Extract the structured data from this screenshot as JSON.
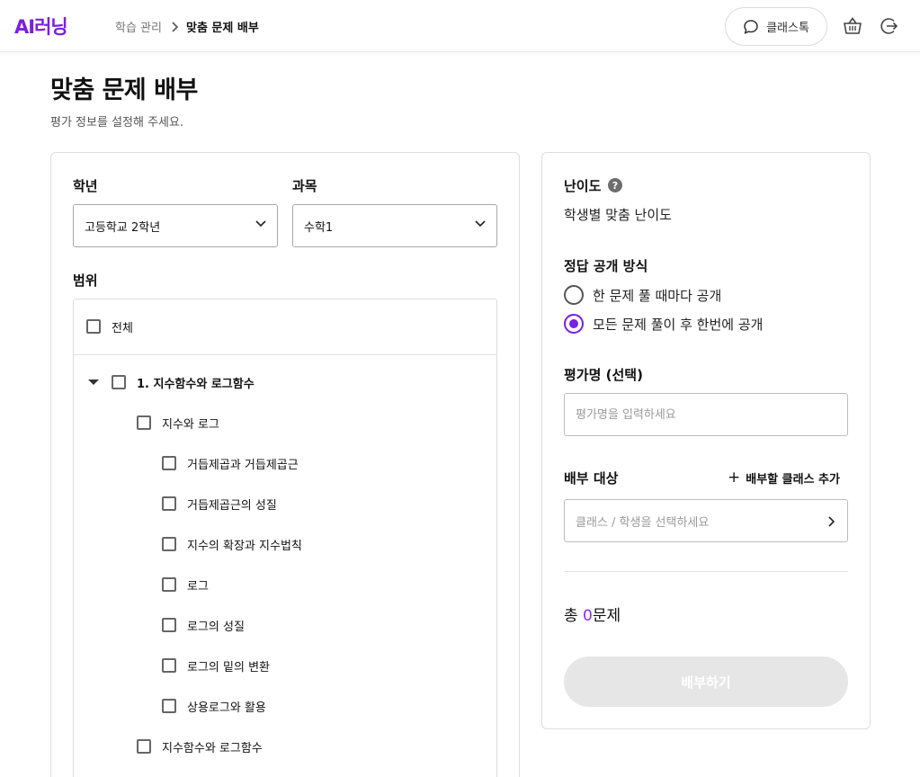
{
  "header": {
    "logo": "AI러닝",
    "breadcrumb_parent": "학습 관리",
    "breadcrumb_current": "맞춤 문제 배부",
    "classtalk_label": "클래스톡"
  },
  "page": {
    "title": "맞춤 문제 배부",
    "subtitle": "평가 정보를 설정해 주세요."
  },
  "left": {
    "grade_label": "학년",
    "grade_value": "고등학교 2학년",
    "subject_label": "과목",
    "subject_value": "수학1",
    "range_label": "범위",
    "all_label": "전체",
    "tree": [
      {
        "level": 0,
        "label": "1. 지수함수와 로그함수",
        "expanded": true
      },
      {
        "level": 1,
        "label": "지수와 로그"
      },
      {
        "level": 2,
        "label": "거듭제곱과 거듭제곱근"
      },
      {
        "level": 2,
        "label": "거듭제곱근의 성질"
      },
      {
        "level": 2,
        "label": "지수의 확장과 지수법칙"
      },
      {
        "level": 2,
        "label": "로그"
      },
      {
        "level": 2,
        "label": "로그의 성질"
      },
      {
        "level": 2,
        "label": "로그의 밑의 변환"
      },
      {
        "level": 2,
        "label": "상용로그와 활용"
      },
      {
        "level": 1,
        "label": "지수함수와 로그함수"
      }
    ]
  },
  "right": {
    "difficulty_label": "난이도",
    "help_glyph": "?",
    "difficulty_value": "학생별 맞춤 난이도",
    "answer_label": "정답 공개 방식",
    "answer_options": [
      {
        "label": "한 문제 풀 때마다 공개",
        "selected": false
      },
      {
        "label": "모든 문제 풀이 후 한번에 공개",
        "selected": true
      }
    ],
    "name_label": "평가명 (선택)",
    "name_placeholder": "평가명을 입력하세요",
    "target_label": "배부 대상",
    "add_class_label": "배부할 클래스 추가",
    "target_placeholder": "클래스 / 학생을 선택하세요",
    "total_prefix": "총 ",
    "total_count": "0",
    "total_suffix": "문제",
    "submit_label": "배부하기"
  },
  "colors": {
    "brand": "#7b1fe0",
    "count": "#8c2be6",
    "disabled_button": "#e6e6e6"
  }
}
